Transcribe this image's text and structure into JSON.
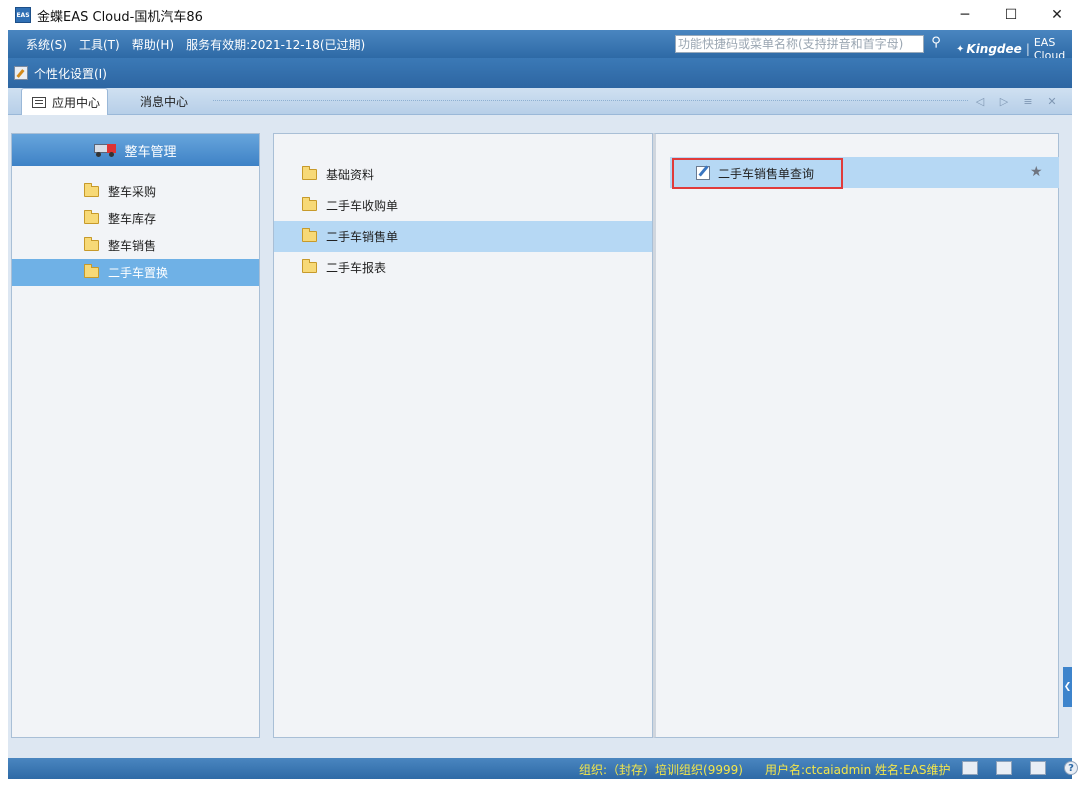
{
  "window": {
    "app_icon_text": "EAS",
    "title": "金蝶EAS Cloud-国机汽车86",
    "minimize": "─",
    "maximize": "☐",
    "close": "✕"
  },
  "menubar": {
    "items": [
      "系统(S)",
      "工具(T)",
      "帮助(H)",
      "服务有效期:2021-12-18(已过期)"
    ],
    "search_placeholder": "功能快捷码或菜单名称(支持拼音和首字母)",
    "brand_name": "Kingdee",
    "brand_product": "EAS Cloud"
  },
  "persbar": {
    "label": "个性化设置(I)"
  },
  "tabs": {
    "items": [
      {
        "label": "应用中心",
        "active": true
      },
      {
        "label": "消息中心",
        "active": false
      }
    ]
  },
  "left_panel": {
    "header": "整车管理",
    "items": [
      {
        "label": "整车采购",
        "selected": false
      },
      {
        "label": "整车库存",
        "selected": false
      },
      {
        "label": "整车销售",
        "selected": false
      },
      {
        "label": "二手车置换",
        "selected": true
      }
    ]
  },
  "mid_panel": {
    "items": [
      {
        "label": "基础资料",
        "selected": false
      },
      {
        "label": "二手车收购单",
        "selected": false
      },
      {
        "label": "二手车销售单",
        "selected": true
      },
      {
        "label": "二手车报表",
        "selected": false
      }
    ]
  },
  "right_panel": {
    "items": [
      {
        "label": "二手车销售单查询",
        "highlighted": true
      }
    ]
  },
  "statusbar": {
    "org": "组织:（封存）培训组织(9999)",
    "user": "用户名:ctcaiadmin  姓名:EAS维护",
    "help": "?"
  },
  "colors": {
    "menubar": "#2e6aa6",
    "selected_left": "#6fb1e6",
    "selected_mid": "#b6d8f4",
    "highlight_border": "#e03b3b",
    "status_text": "#f4e64a"
  }
}
